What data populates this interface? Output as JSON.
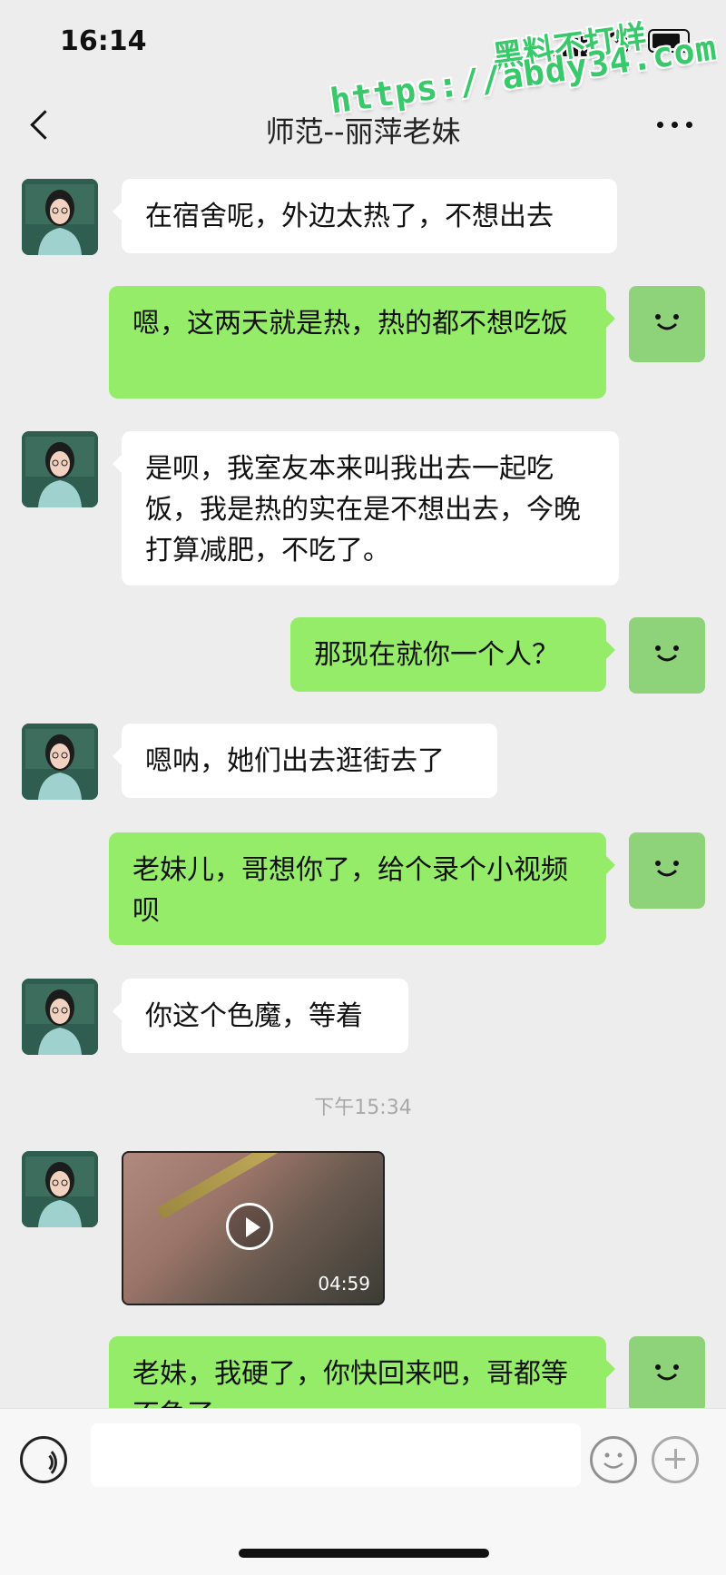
{
  "status_bar": {
    "time": "16:14"
  },
  "watermark": {
    "line1": "黑料不打烊",
    "line2": "https://abdy34.com"
  },
  "nav": {
    "title": "师范--丽萍老妹",
    "back_icon": "chevron-left-icon",
    "more_icon": "more-dots-icon"
  },
  "messages": [
    {
      "side": "left",
      "text": "在宿舍呢，外边太热了，不想出去"
    },
    {
      "side": "right",
      "text": "嗯，这两天就是热，热的都不想吃饭"
    },
    {
      "side": "left",
      "text": "是呗，我室友本来叫我出去一起吃饭，我是热的实在是不想出去，今晚打算减肥，不吃了。"
    },
    {
      "side": "right",
      "text": "那现在就你一个人？"
    },
    {
      "side": "left",
      "text": "嗯呐，她们出去逛街去了"
    },
    {
      "side": "right",
      "text": "老妹儿，哥想你了，给个录个小视频呗"
    },
    {
      "side": "left",
      "text": "你这个色魔，等着"
    },
    {
      "side": "right",
      "text": "老妹，我硬了，你快回来吧，哥都等不急了"
    }
  ],
  "timestamp": "下午15:34",
  "video": {
    "duration": "04:59"
  },
  "colors": {
    "background": "#ededed",
    "sent_bubble": "#95ec69",
    "received_bubble": "#ffffff",
    "watermark": "#38c96b"
  },
  "input_bar": {
    "voice_icon": "voice-icon",
    "emoji_icon": "emoji-icon",
    "plus_icon": "plus-icon"
  }
}
